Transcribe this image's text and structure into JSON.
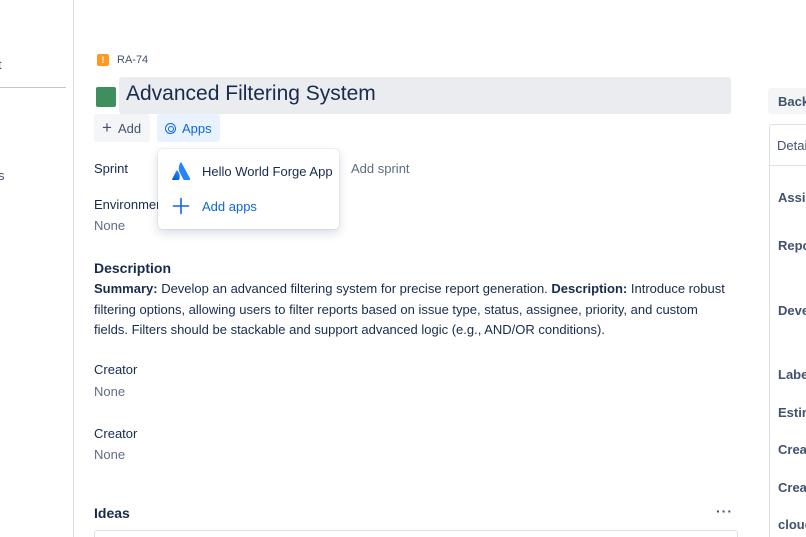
{
  "left_rail": {
    "fragment_1": "t",
    "fragment_2": "s"
  },
  "issue": {
    "key": "RA-74",
    "title": "Advanced Filtering System",
    "type_icon": "bug-icon",
    "status_color": "#3e8e5e"
  },
  "toolbar": {
    "add_label": "Add",
    "apps_label": "Apps"
  },
  "apps_dropdown": {
    "items": [
      {
        "label": "Hello World Forge App",
        "icon": "atlassian-logo-icon"
      },
      {
        "label": "Add apps",
        "icon": "plus-icon"
      }
    ]
  },
  "fields": {
    "sprint_label": "Sprint",
    "sprint_value": "Add sprint",
    "environment_label": "Environment",
    "environment_value": "None"
  },
  "description": {
    "heading": "Description",
    "summary_label": "Summary:",
    "summary_text": " Develop an advanced filtering system for precise report generation.  ",
    "desc_label": "Description:",
    "desc_text": " Introduce robust filtering options, allowing users to filter reports based on issue type, status, assignee, priority, and custom fields. Filters should be stackable and support advanced logic (e.g., AND/OR conditions)."
  },
  "creator_1": {
    "label": "Creator",
    "value": "None"
  },
  "creator_2": {
    "label": "Creator",
    "value": "None"
  },
  "ideas": {
    "heading": "Ideas",
    "more": "···"
  },
  "right_panel": {
    "back_label": "Back",
    "details_label": "Detai",
    "labels": [
      "Assig",
      "Repo",
      "Deve",
      "Labe",
      "Estin",
      "Crea",
      "Crea",
      "cloud"
    ]
  },
  "colors": {
    "accent": "#0c66e4",
    "bug": "#ff991f",
    "text": "#172b4d"
  }
}
